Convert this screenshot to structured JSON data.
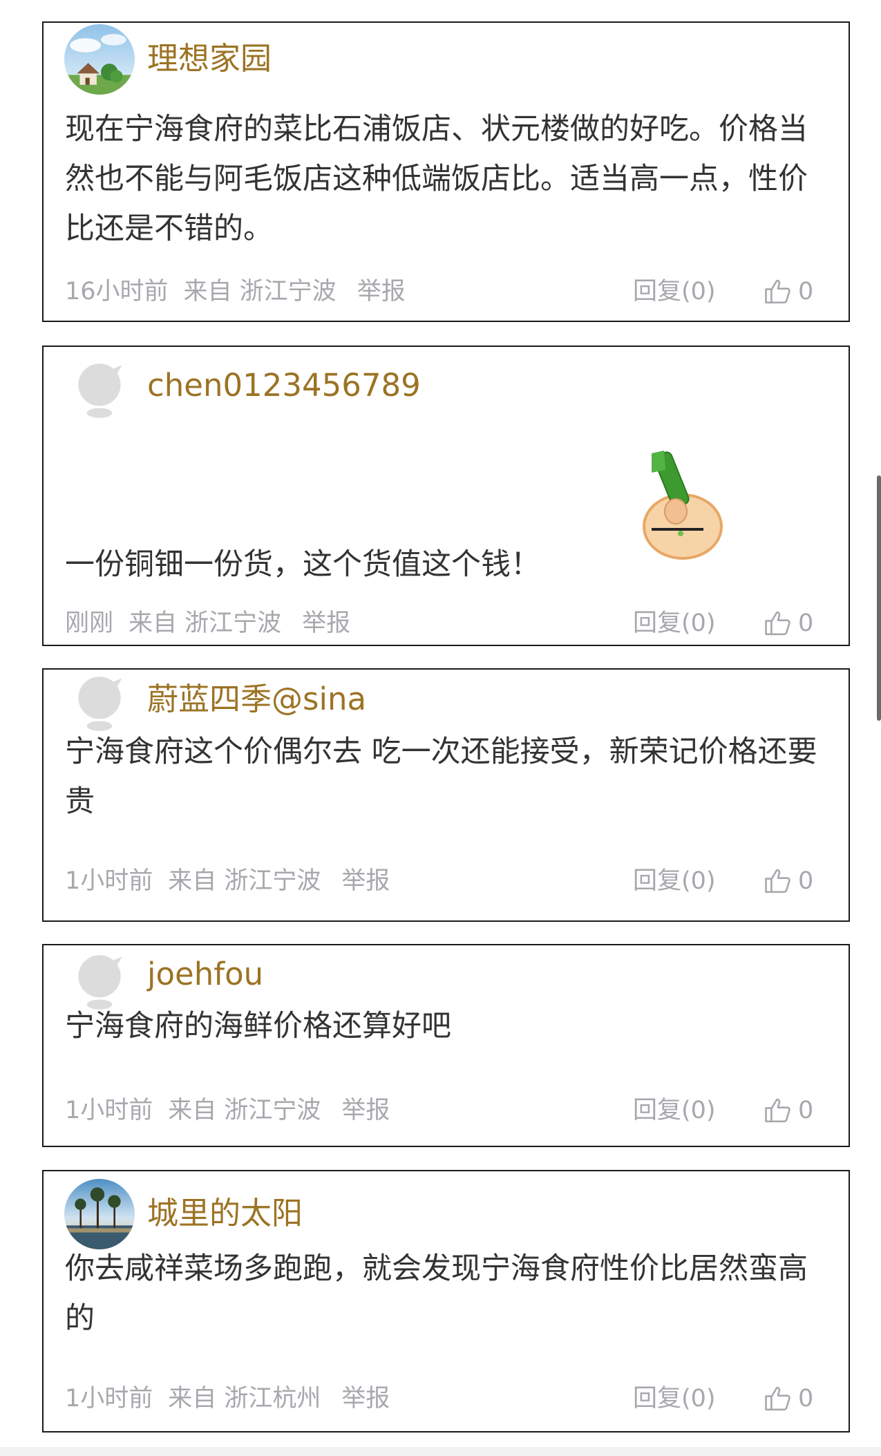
{
  "comments": [
    {
      "username": "理想家园",
      "avatar": "avatar-house-photo",
      "content": "现在宁海食府的菜比石浦饭店、状元楼做的好吃。价格当然也不能与阿毛饭店这种低端饭店比。适当高一点，性价比还是不错的。",
      "time": "16小时前",
      "source": "来自 浙江宁波",
      "report": "举报",
      "reply": "回复(0)",
      "likes": "0"
    },
    {
      "username": "chen0123456789",
      "avatar": "default-avatar",
      "content": "一份铜钿一份货，这个货值这个钱！",
      "emoji": "thumbs-up-emoji",
      "time": "刚刚",
      "source": "来自 浙江宁波",
      "report": "举报",
      "reply": "回复(0)",
      "likes": "0"
    },
    {
      "username": "蔚蓝四季@sina",
      "avatar": "default-avatar",
      "content": "宁海食府这个价偶尔去 吃一次还能接受，新荣记价格还要贵",
      "time": "1小时前",
      "source": "来自 浙江宁波",
      "report": "举报",
      "reply": "回复(0)",
      "likes": "0"
    },
    {
      "username": "joehfou",
      "avatar": "default-avatar",
      "content": "宁海食府的海鲜价格还算好吧",
      "time": "1小时前",
      "source": "来自 浙江宁波",
      "report": "举报",
      "reply": "回复(0)",
      "likes": "0"
    },
    {
      "username": "城里的太阳",
      "avatar": "avatar-landscape-photo",
      "content": "你去咸祥菜场多跑跑，就会发现宁海食府性价比居然蛮高的",
      "time": "1小时前",
      "source": "来自 浙江杭州",
      "report": "举报",
      "reply": "回复(0)",
      "likes": "0"
    }
  ],
  "colors": {
    "username": "#9c7324",
    "content": "#333333",
    "meta": "#a7a8ad",
    "border": "#1a1a1a"
  },
  "icons": {
    "like": "thumbs-up-outline-icon"
  }
}
